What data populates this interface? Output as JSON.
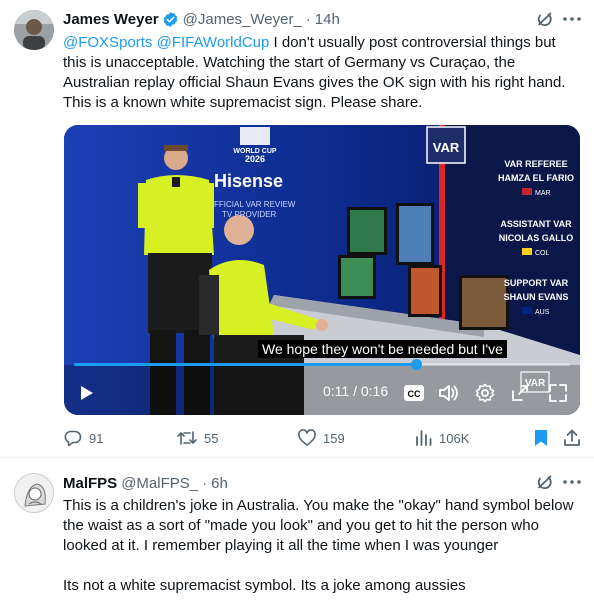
{
  "tweet": {
    "author_name": "James Weyer",
    "handle": "@James_Weyer_",
    "dot": "·",
    "time": "14h",
    "mention1": "@FOXSports",
    "mention2": "@FIFAWorldCup",
    "body": " I don't usually post controversial things but this is unacceptable. Watching the start of Germany vs Curaçao, the Australian replay official Shaun Evans gives the OK sign with his right hand. This is a known white supremacist sign. Please share.",
    "video": {
      "logo_line1": "WORLD CUP",
      "logo_line2": "2026",
      "sponsor": "Hisense",
      "sponsor_sub1": "FFICIAL VAR REVIEW",
      "sponsor_sub2": "TV PROVIDER",
      "var_sign": "VAR",
      "graphics": [
        {
          "role": "VAR REFEREE",
          "name": "HAMZA EL FARIO",
          "country": "MAR"
        },
        {
          "role": "ASSISTANT VAR",
          "name": "NICOLAS GALLO",
          "country": "COL"
        },
        {
          "role": "SUPPORT VAR",
          "name": "SHAUN EVANS",
          "country": "AUS"
        }
      ],
      "caption": "We hope they won't be needed but I've",
      "timecode": "0:11 / 0:16",
      "progress": 0.69,
      "cc_label": "CC"
    },
    "stats": {
      "replies": "91",
      "reposts": "55",
      "likes": "159",
      "views": "106K"
    }
  },
  "reply": {
    "author_name": "MalFPS",
    "handle": "@MalFPS_",
    "dot": "·",
    "time": "6h",
    "para1": "This is a children's joke in Australia. You make the \"okay\" hand symbol below the waist as a sort of \"made you look\" and you get to hit the person who looked at it. I remember playing it all the time when I was younger",
    "para2": "Its not a white supremacist symbol. Its a joke among aussies"
  },
  "colors": {
    "accent": "#1d9bf0",
    "secondary_text": "#536471",
    "var_panel": "#0a1a5c"
  },
  "icons": [
    "verified-badge-icon",
    "grok-icon",
    "more-icon",
    "play-icon",
    "cc-icon",
    "volume-icon",
    "settings-icon",
    "pip-icon",
    "fullscreen-icon",
    "reply-icon",
    "repost-icon",
    "like-icon",
    "views-icon",
    "bookmark-icon",
    "share-icon"
  ]
}
